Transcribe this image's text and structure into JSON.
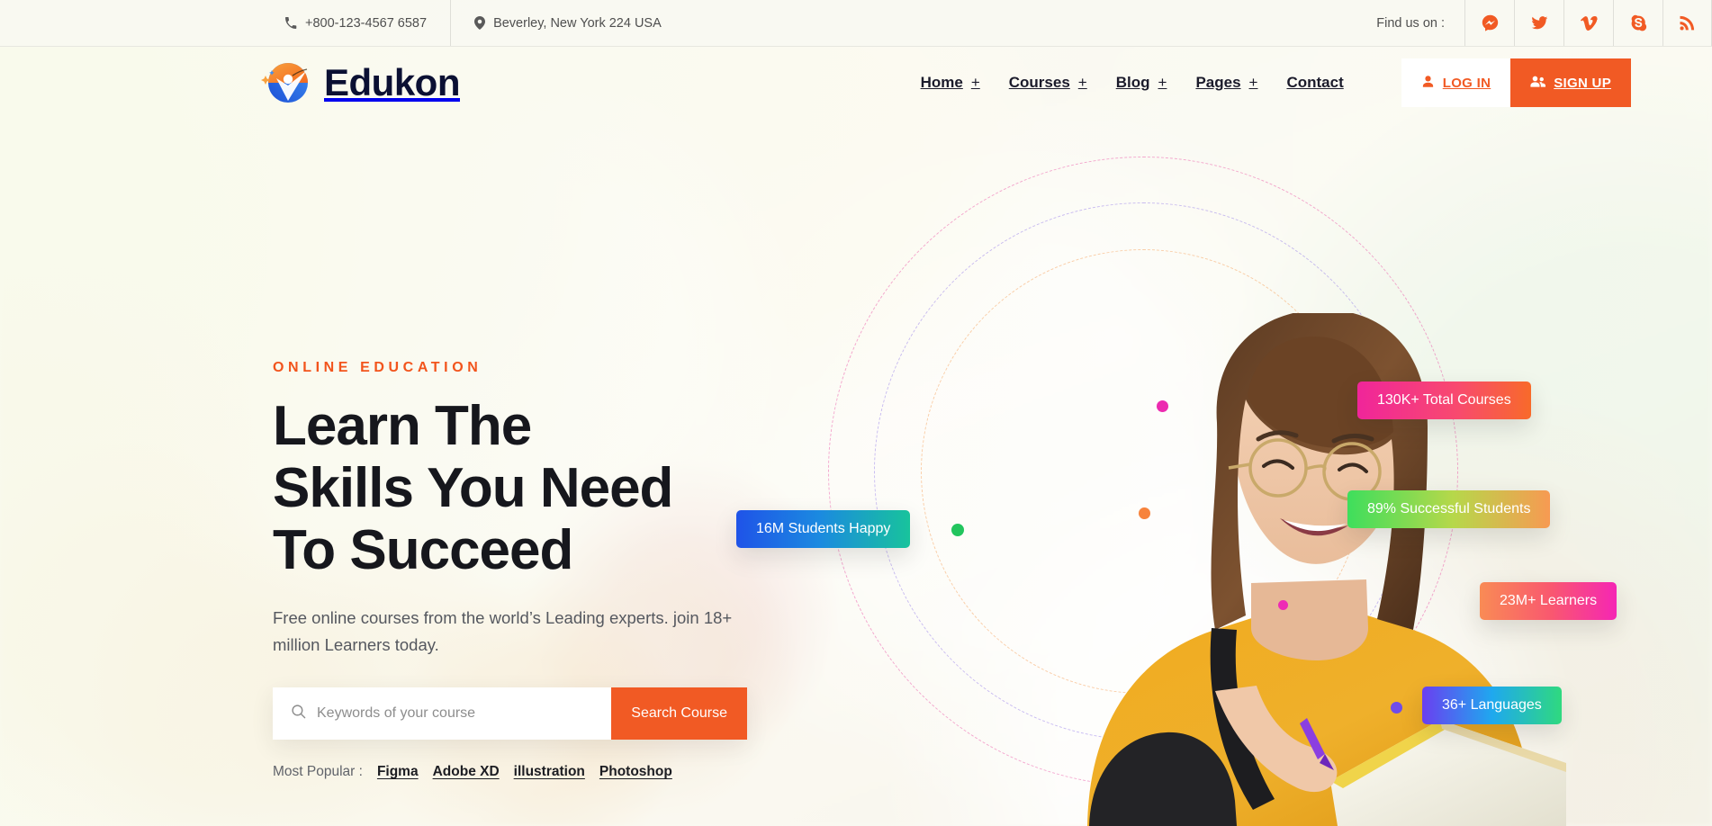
{
  "topbar": {
    "phone": "+800-123-4567 6587",
    "address": "Beverley, New York 224 USA",
    "find_us_label": "Find us on :",
    "socials": [
      {
        "name": "messenger-icon"
      },
      {
        "name": "twitter-icon"
      },
      {
        "name": "vimeo-icon"
      },
      {
        "name": "skype-icon"
      },
      {
        "name": "rss-icon"
      }
    ]
  },
  "header": {
    "brand": "Edukon",
    "nav": [
      {
        "label": "Home",
        "has_plus": true
      },
      {
        "label": "Courses",
        "has_plus": true
      },
      {
        "label": "Blog",
        "has_plus": true
      },
      {
        "label": "Pages",
        "has_plus": true
      },
      {
        "label": "Contact",
        "has_plus": false
      }
    ],
    "plus": "+",
    "login_label": "LOG IN",
    "signup_label": "SIGN UP"
  },
  "hero": {
    "eyebrow": "ONLINE EDUCATION",
    "headline_line1": "Learn The",
    "headline_line2": "Skills You Need",
    "headline_line3": "To Succeed",
    "subcopy": "Free online courses from the world’s Leading experts. join 18+ million Learners today.",
    "search": {
      "placeholder": "Keywords of your course",
      "value": "",
      "button_label": "Search Course"
    },
    "popular_label": "Most Popular :",
    "popular_links": [
      "Figma",
      "Adobe XD",
      "illustration",
      "Photoshop"
    ],
    "badges": [
      {
        "text": "16M Students Happy",
        "gradient": "linear-gradient(90deg,#1f53e8 0%,#1b8ae0 48%,#18c39c 100%)"
      },
      {
        "text": "130K+ Total Courses",
        "gradient": "linear-gradient(90deg,#f0259a 0%,#f84a6e 58%,#f86a2a 100%)"
      },
      {
        "text": "89% Successful Students",
        "gradient": "linear-gradient(90deg,#3ede5c 0%,#b6d84a 52%,#f79a52 100%)"
      },
      {
        "text": "23M+ Learners",
        "gradient": "linear-gradient(90deg,#f98b55 0%,#f9586f 52%,#f526b4 100%)"
      },
      {
        "text": "36+ Languages",
        "gradient": "linear-gradient(90deg,#6a3ff0 0%,#1fa8ef 50%,#2fd97f 100%)"
      }
    ]
  },
  "colors": {
    "accent": "#f15a24",
    "heading": "#16171d",
    "brand_dark": "#0b1033",
    "logo_orange": "#f58220",
    "logo_blue": "#1f6fe0"
  }
}
